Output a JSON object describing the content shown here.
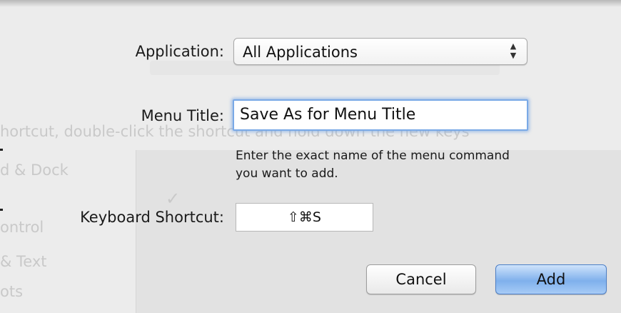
{
  "dialog": {
    "application": {
      "label": "Application:",
      "selected": "All Applications",
      "arrows_glyph": "⬍"
    },
    "menu_title": {
      "label": "Menu Title:",
      "value": "Save As for Menu Title",
      "hint_line1": "Enter the exact name of the menu command",
      "hint_line2": "you want to add."
    },
    "keyboard_shortcut": {
      "label": "Keyboard Shortcut:",
      "value": "⇧⌘S"
    },
    "buttons": {
      "cancel": "Cancel",
      "add": "Add"
    },
    "colors": {
      "accent_focus": "#7aa9e6",
      "default_button": "#7fb0ec",
      "sheet_background": "#ececec"
    }
  },
  "background_window": {
    "ghost_text_1": "hortcut, double-click the shortcut and hold down the new keys",
    "ghost_text_2": "d & Dock",
    "ghost_text_3": "ontrol",
    "ghost_text_4": "& Text",
    "ghost_text_5": "ots"
  }
}
